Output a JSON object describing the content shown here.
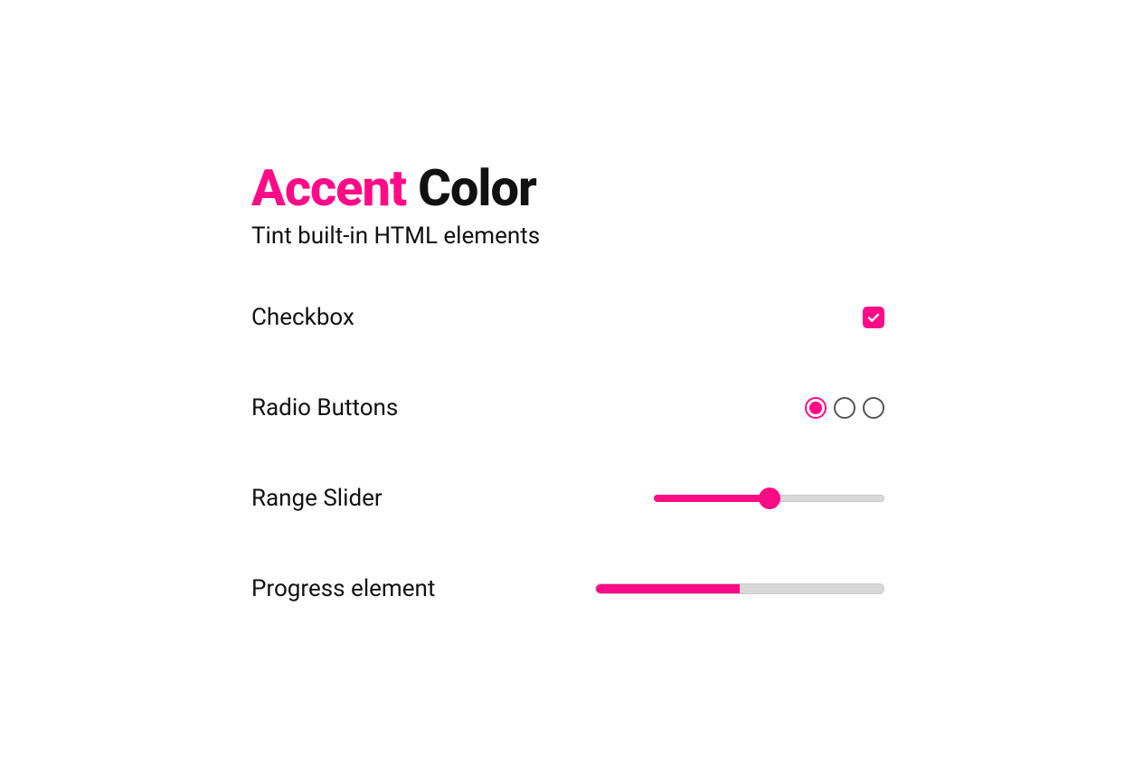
{
  "accent_color": "#ff0a87",
  "title": {
    "accent_word": "Accent",
    "rest": " Color"
  },
  "subtitle": "Tint built-in HTML elements",
  "rows": {
    "checkbox": {
      "label": "Checkbox",
      "checked": true
    },
    "radio": {
      "label": "Radio Buttons",
      "options": [
        {
          "selected": true
        },
        {
          "selected": false
        },
        {
          "selected": false
        }
      ]
    },
    "range": {
      "label": "Range Slider",
      "value": 50,
      "min": 0,
      "max": 100
    },
    "progress": {
      "label": "Progress element",
      "value": 50,
      "max": 100
    }
  }
}
